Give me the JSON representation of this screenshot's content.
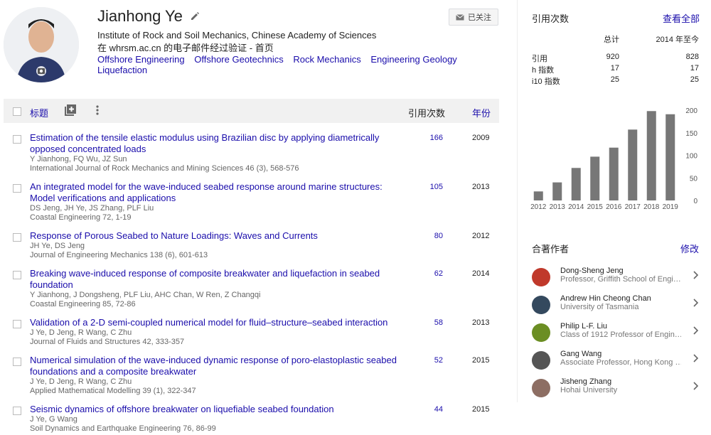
{
  "profile": {
    "name": "Jianhong Ye",
    "affiliation": "Institute of Rock and Soil Mechanics, Chinese Academy of Sciences",
    "verified_email": "在 whrsm.ac.cn 的电子邮件经过验证",
    "separator": " - ",
    "homepage_label": "首页",
    "interests": [
      "Offshore Engineering",
      "Offshore Geotechnics",
      "Rock Mechanics",
      "Engineering Geology",
      "Liquefaction"
    ],
    "follow_label": "已关注"
  },
  "table": {
    "title_label": "标题",
    "cited_label": "引用次数",
    "year_label": "年份",
    "articles": [
      {
        "title": "Estimation of the tensile elastic modulus using Brazilian disc by applying diametrically opposed concentrated loads",
        "authors": "Y Jianhong, FQ Wu, JZ Sun",
        "venue": "International Journal of Rock Mechanics and Mining Sciences 46 (3), 568-576",
        "cites": "166",
        "year": "2009"
      },
      {
        "title": "An integrated model for the wave-induced seabed response around marine structures: Model verifications and applications",
        "authors": "DS Jeng, JH Ye, JS Zhang, PLF Liu",
        "venue": "Coastal Engineering 72, 1-19",
        "cites": "105",
        "year": "2013"
      },
      {
        "title": "Response of Porous Seabed to Nature Loadings: Waves and Currents",
        "authors": "JH Ye, DS Jeng",
        "venue": "Journal of Engineering Mechanics 138 (6), 601-613",
        "cites": "80",
        "year": "2012"
      },
      {
        "title": "Breaking wave-induced response of composite breakwater and liquefaction in seabed foundation",
        "authors": "Y Jianhong, J Dongsheng, PLF Liu, AHC Chan, W Ren, Z Changqi",
        "venue": "Coastal Engineering 85, 72-86",
        "cites": "62",
        "year": "2014"
      },
      {
        "title": "Validation of a 2-D semi-coupled numerical model for fluid–structure–seabed interaction",
        "authors": "J Ye, D Jeng, R Wang, C Zhu",
        "venue": "Journal of Fluids and Structures 42, 333-357",
        "cites": "58",
        "year": "2013"
      },
      {
        "title": "Numerical simulation of the wave-induced dynamic response of poro-elastoplastic seabed foundations and a composite breakwater",
        "authors": "J Ye, D Jeng, R Wang, C Zhu",
        "venue": "Applied Mathematical Modelling 39 (1), 322-347",
        "cites": "52",
        "year": "2015"
      },
      {
        "title": "Seismic dynamics of offshore breakwater on liquefiable seabed foundation",
        "authors": "J Ye, G Wang",
        "venue": "Soil Dynamics and Earthquake Engineering 76, 86-99",
        "cites": "44",
        "year": "2015"
      }
    ]
  },
  "citations": {
    "heading": "引用次数",
    "view_all": "查看全部",
    "col_total": "总计",
    "col_since": "2014 年至今",
    "rows": [
      {
        "label": "引用",
        "total": "920",
        "since": "828"
      },
      {
        "label": "h 指数",
        "total": "17",
        "since": "17"
      },
      {
        "label": "i10 指数",
        "total": "25",
        "since": "25"
      }
    ]
  },
  "chart_data": {
    "type": "bar",
    "categories": [
      "2012",
      "2013",
      "2014",
      "2015",
      "2016",
      "2017",
      "2018",
      "2019"
    ],
    "values": [
      20,
      40,
      72,
      97,
      117,
      157,
      198,
      191
    ],
    "yticks": [
      "0",
      "50",
      "100",
      "150",
      "200"
    ],
    "ylim": [
      0,
      200
    ],
    "bar_color": "#777777"
  },
  "coauthors": {
    "heading": "合著作者",
    "edit_label": "修改",
    "items": [
      {
        "name": "Dong-Sheng Jeng",
        "affiliation": "Professor, Griffith School of Engi…",
        "color": "#c0392b"
      },
      {
        "name": "Andrew Hin Cheong Chan",
        "affiliation": "University of Tasmania",
        "color": "#34495e"
      },
      {
        "name": "Philip L-F. Liu",
        "affiliation": "Class of 1912 Professor of Engin…",
        "color": "#6b8e23"
      },
      {
        "name": "Gang Wang",
        "affiliation": "Associate Professor, Hong Kong …",
        "color": "#555555"
      },
      {
        "name": "Jisheng Zhang",
        "affiliation": "Hohai University",
        "color": "#8d6e63"
      }
    ]
  },
  "icons": {
    "edit": "pencil-icon",
    "follow": "envelope-icon",
    "add": "add-to-library-icon",
    "more": "more-vert-icon",
    "chevron": "chevron-right-icon",
    "photo": "camera-icon"
  }
}
